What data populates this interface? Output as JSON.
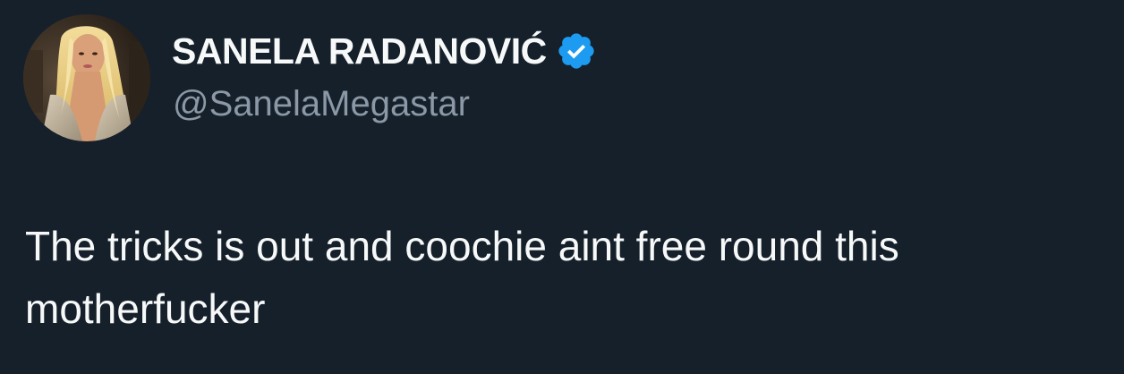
{
  "tweet": {
    "author": {
      "display_name": "SANELA RADANOVIĆ",
      "handle": "@SanelaMegastar",
      "verified": true,
      "avatar_icon": "profile-photo",
      "verified_icon": "verified-badge-icon"
    },
    "text": "The tricks is out and coochie aint free round this motherfucker"
  },
  "colors": {
    "background": "#15202b",
    "primary_text": "#f7f9f9",
    "secondary_text": "#8b98a5",
    "verified_badge": "#1d9bf0"
  }
}
